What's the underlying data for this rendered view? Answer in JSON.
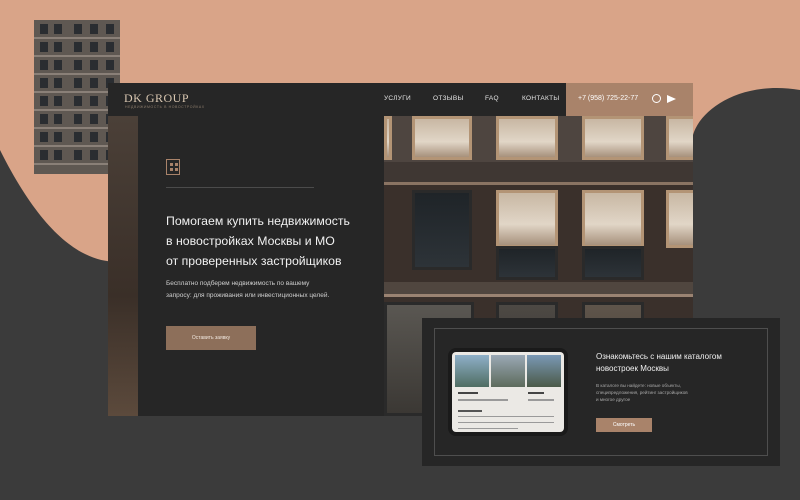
{
  "site": {
    "logo": "DK GROUP",
    "logo_sub": "НЕДВИЖИМОСТЬ В НОВОСТРОЙКАХ",
    "nav": [
      "УСЛУГИ",
      "ОТЗЫВЫ",
      "FAQ",
      "КОНТАКТЫ"
    ],
    "phone": "+7 (958) 725-22-77"
  },
  "hero": {
    "headline_1": "Помогаем купить недвижимость",
    "headline_2": "в новостройках Москвы и МО",
    "headline_3": "от проверенных застройщиков",
    "sub_1": "Бесплатно подберем недвижимость по вашему",
    "sub_2": "запросу: для проживания или инвестиционных целей.",
    "cta": "Оставить заявку"
  },
  "catalog": {
    "title_1": "Ознакомьтесь с нашим каталогом",
    "title_2": "новостроек Москвы",
    "text_1": "В каталоге вы найдете: новые объекты,",
    "text_2": "специпредложения, рейтинг застройщиков",
    "text_3": "и многое другое",
    "button": "Смотреть"
  },
  "colors": {
    "accent": "#a9836a",
    "dark": "#262626",
    "peach": "#d9a488",
    "background": "#3b3b3b"
  }
}
